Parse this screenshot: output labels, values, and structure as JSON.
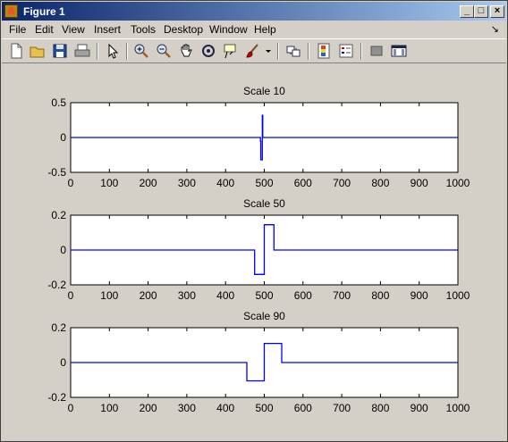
{
  "window": {
    "title": "Figure 1",
    "minimize": "_",
    "maximize": "□",
    "close": "×"
  },
  "menu": {
    "items": [
      "File",
      "Edit",
      "View",
      "Insert",
      "Tools",
      "Desktop",
      "Window",
      "Help"
    ],
    "dock_arrow": "↘"
  },
  "toolbar": {
    "icons": [
      "new-figure",
      "open-file",
      "save",
      "print",
      "select-arrow",
      "zoom-in",
      "zoom-out",
      "pan-hand",
      "rotate-3d",
      "data-cursor",
      "brush",
      "brush-dropdown",
      "link-plot",
      "colorbar",
      "legend",
      "hide-plot-tools",
      "show-plot-tools"
    ]
  },
  "colors": {
    "plot_line": "#0000ff",
    "axes_bg": "#ffffff",
    "figure_bg": "#d4d0c8"
  },
  "chart_data": [
    {
      "type": "line",
      "title": "Scale 10",
      "xlim": [
        0,
        1000
      ],
      "ylim": [
        -0.5,
        0.5
      ],
      "xticks": [
        "0",
        "100",
        "200",
        "300",
        "400",
        "500",
        "600",
        "700",
        "800",
        "900",
        "1000"
      ],
      "yticks": [
        "0.5",
        "0",
        "-0.5"
      ],
      "ytick_values": [
        0.5,
        0,
        -0.5
      ],
      "series": [
        {
          "x": [
            0,
            490,
            490,
            491,
            491,
            495,
            495,
            496,
            496,
            1000
          ],
          "y": [
            0,
            0,
            -0.05,
            -0.05,
            -0.32,
            -0.32,
            0.32,
            0.32,
            0,
            0
          ]
        }
      ]
    },
    {
      "type": "line",
      "title": "Scale 50",
      "xlim": [
        0,
        1000
      ],
      "ylim": [
        -0.2,
        0.2
      ],
      "xticks": [
        "0",
        "100",
        "200",
        "300",
        "400",
        "500",
        "600",
        "700",
        "800",
        "900",
        "1000"
      ],
      "yticks": [
        "0.2",
        "0",
        "-0.2"
      ],
      "ytick_values": [
        0.2,
        0,
        -0.2
      ],
      "series": [
        {
          "x": [
            0,
            475,
            475,
            500,
            500,
            525,
            525,
            1000
          ],
          "y": [
            0,
            0,
            -0.14,
            -0.14,
            0.145,
            0.145,
            0,
            0
          ]
        }
      ]
    },
    {
      "type": "line",
      "title": "Scale 90",
      "xlim": [
        0,
        1000
      ],
      "ylim": [
        -0.2,
        0.2
      ],
      "xticks": [
        "0",
        "100",
        "200",
        "300",
        "400",
        "500",
        "600",
        "700",
        "800",
        "900",
        "1000"
      ],
      "yticks": [
        "0.2",
        "0",
        "-0.2"
      ],
      "ytick_values": [
        0.2,
        0,
        -0.2
      ],
      "series": [
        {
          "x": [
            0,
            455,
            455,
            500,
            500,
            545,
            545,
            1000
          ],
          "y": [
            0,
            0,
            -0.105,
            -0.105,
            0.11,
            0.11,
            0,
            0
          ]
        }
      ]
    }
  ]
}
